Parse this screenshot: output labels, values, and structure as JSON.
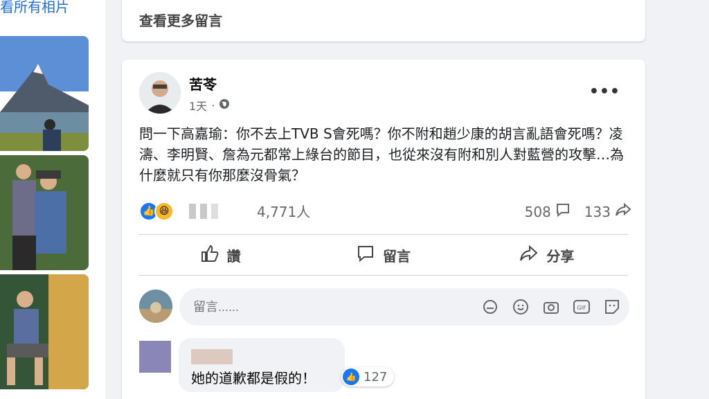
{
  "left": {
    "see_all_photos": "看所有相片"
  },
  "more_comments": "查看更多留言",
  "post": {
    "author": "苦苓",
    "time": "1天",
    "text": "問一下高嘉瑜：你不去上TVB S會死嗎？你不附和趙少康的胡言亂語會死嗎？凌濤、李明賢、詹為元都常上綠台的節目，也從來沒有附和別人對藍營的攻擊…為什麼就只有你那麼沒骨氣？",
    "reaction_count": "4,771人",
    "comment_count": "508",
    "share_count": "133",
    "actions": {
      "like": "讚",
      "comment": "留言",
      "share": "分享"
    },
    "composer_placeholder": "留言......",
    "comment": {
      "text": "她的道歉都是假的！",
      "likes": "127"
    }
  },
  "colors": {
    "accent": "#1877f2",
    "link": "#216fdb",
    "bg": "#f0f2f5"
  }
}
